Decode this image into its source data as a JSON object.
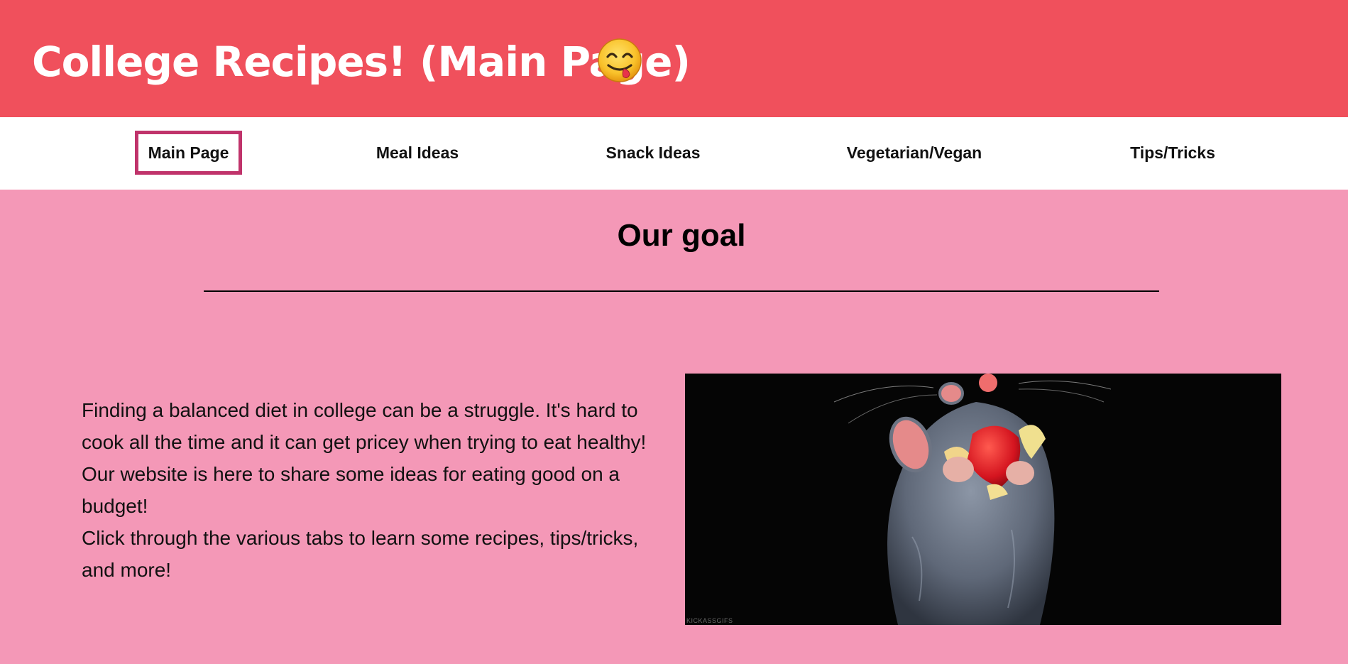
{
  "header": {
    "title": "College Recipes! (Main Page)",
    "emoji": "face-savoring-food-icon",
    "background_color": "#f0505c"
  },
  "nav": {
    "items": [
      {
        "label": "Main Page",
        "active": true
      },
      {
        "label": "Meal Ideas",
        "active": false
      },
      {
        "label": "Snack Ideas",
        "active": false
      },
      {
        "label": "Vegetarian/Vegan",
        "active": false
      },
      {
        "label": "Tips/Tricks",
        "active": false
      }
    ],
    "active_border_color": "#c0336b"
  },
  "main": {
    "background_color": "#f498b7",
    "heading": "Our goal",
    "paragraphs": [
      "Finding a balanced diet in college can be a struggle. It's hard to cook all the time and it can get pricey when trying to eat healthy! Our website is here to share some ideas for eating good on a budget!",
      "Click through the various tabs to learn some recipes, tips/tricks, and more!"
    ],
    "image": {
      "description_icon": "rat-eating-strawberry-gif",
      "credit": "KICKASSGIFS"
    }
  }
}
